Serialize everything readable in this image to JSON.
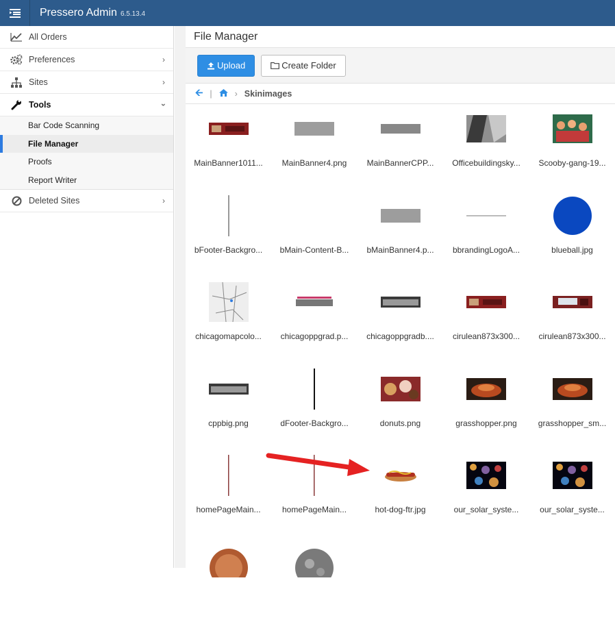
{
  "app": {
    "title": "Pressero Admin",
    "version": "6.5.13.4"
  },
  "sidebar": {
    "items": [
      {
        "label": "All Orders",
        "icon": "line-chart-icon"
      },
      {
        "label": "Preferences",
        "icon": "gears-icon"
      },
      {
        "label": "Sites",
        "icon": "sitemap-icon"
      },
      {
        "label": "Tools",
        "icon": "wrench-icon"
      }
    ],
    "tools_sub": [
      {
        "label": "Bar Code Scanning"
      },
      {
        "label": "File Manager"
      },
      {
        "label": "Proofs"
      },
      {
        "label": "Report Writer"
      }
    ],
    "deleted": {
      "label": "Deleted Sites",
      "icon": "ban-icon"
    }
  },
  "main": {
    "title": "File Manager",
    "upload_label": "Upload",
    "create_folder_label": "Create Folder",
    "breadcrumb_current": "Skinimages"
  },
  "files": [
    {
      "name": "MainBanner1011...",
      "thumb": "banner-red"
    },
    {
      "name": "MainBanner4.png",
      "thumb": "gray-bar"
    },
    {
      "name": "MainBannerCPP...",
      "thumb": "gray-bar-thin"
    },
    {
      "name": "Officebuildingsky...",
      "thumb": "building"
    },
    {
      "name": "Scooby-gang-19...",
      "thumb": "cartoon"
    },
    {
      "name": "bFooter-Backgro...",
      "thumb": "vline-gray"
    },
    {
      "name": "bMain-Content-B...",
      "thumb": "blank"
    },
    {
      "name": "bMainBanner4.p...",
      "thumb": "gray-bar"
    },
    {
      "name": "bbrandingLogoA...",
      "thumb": "tiny-text"
    },
    {
      "name": "blueball.jpg",
      "thumb": "blue-ball"
    },
    {
      "name": "chicagomapcolo...",
      "thumb": "map"
    },
    {
      "name": "chicagoppgrad.p...",
      "thumb": "chicago-logo"
    },
    {
      "name": "chicagoppgradb....",
      "thumb": "chicago-logo-dark"
    },
    {
      "name": "cirulean873x300...",
      "thumb": "banner-red"
    },
    {
      "name": "cirulean873x300...",
      "thumb": "banner-red2"
    },
    {
      "name": "cppbig.png",
      "thumb": "chicago-logo-dark"
    },
    {
      "name": "dFooter-Backgro...",
      "thumb": "vline-black"
    },
    {
      "name": "donuts.png",
      "thumb": "donuts"
    },
    {
      "name": "grasshopper.png",
      "thumb": "grasshopper"
    },
    {
      "name": "grasshopper_sm...",
      "thumb": "grasshopper"
    },
    {
      "name": "homePageMain...",
      "thumb": "vline-brown"
    },
    {
      "name": "homePageMain...",
      "thumb": "vline-brown"
    },
    {
      "name": "hot-dog-ftr.jpg",
      "thumb": "hotdog"
    },
    {
      "name": "our_solar_syste...",
      "thumb": "solar"
    },
    {
      "name": "our_solar_syste...",
      "thumb": "solar"
    },
    {
      "name": "",
      "thumb": "mars"
    },
    {
      "name": "",
      "thumb": "moon"
    }
  ],
  "colors": {
    "topbar": "#2d5b8c",
    "accent": "#2e8ee4",
    "arrow": "#e52222"
  }
}
